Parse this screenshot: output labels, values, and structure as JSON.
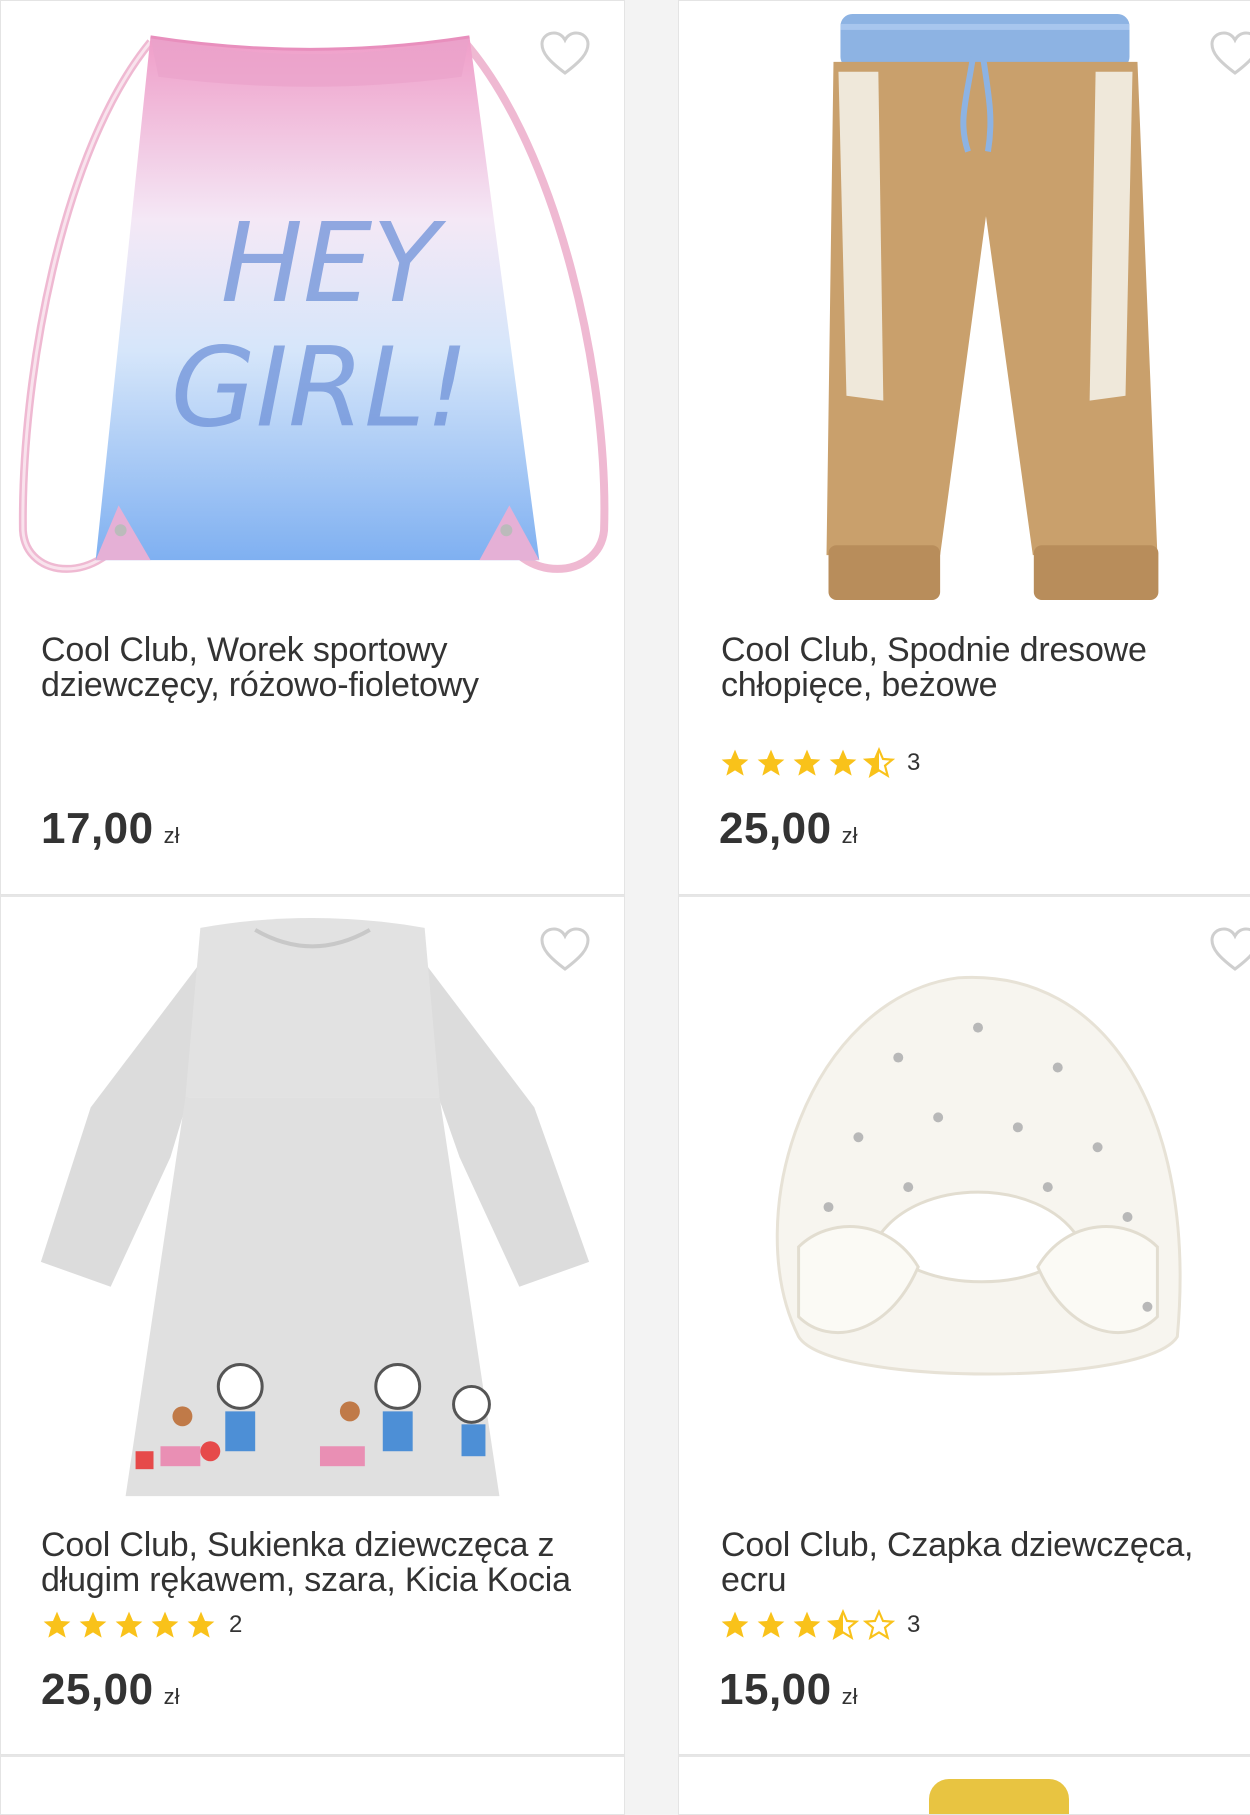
{
  "products": [
    {
      "title": "Cool Club, Worek sportowy dziewczęcy, różowo-fioletowy",
      "image_alt": "HEY GIRL!",
      "rating": null,
      "rating_count": null,
      "price": "17,00",
      "currency": "zł"
    },
    {
      "title": "Cool Club, Spodnie dresowe chłopięce, beżowe",
      "rating": 4.5,
      "rating_count": "3",
      "price": "25,00",
      "currency": "zł"
    },
    {
      "title": "Cool Club, Sukienka dziewczęca z długim rękawem, szara, Kicia Kocia",
      "rating": 5,
      "rating_count": "2",
      "price": "25,00",
      "currency": "zł"
    },
    {
      "title": "Cool Club, Czapka dziewczęca, ecru",
      "rating": 3.5,
      "rating_count": "3",
      "price": "15,00",
      "currency": "zł"
    }
  ],
  "colors": {
    "star": "#f9c21a",
    "text": "#333333",
    "heart_outline": "#cfcfcf"
  }
}
